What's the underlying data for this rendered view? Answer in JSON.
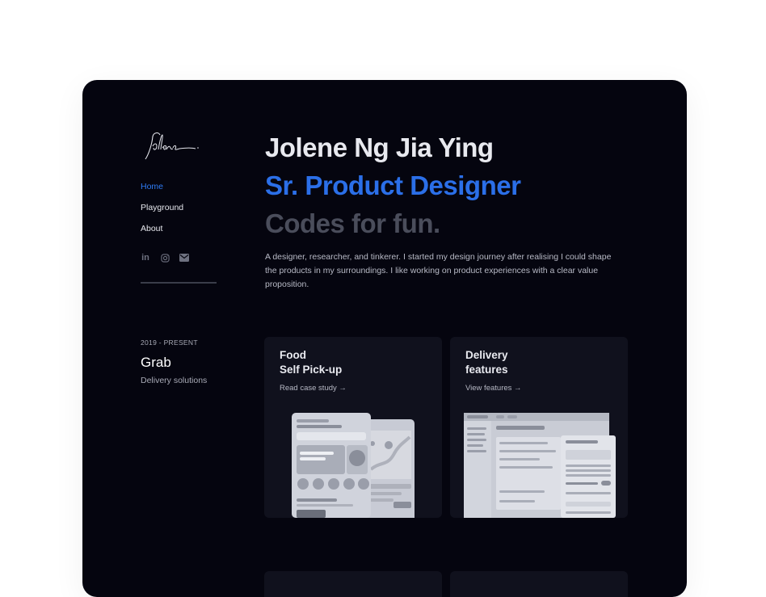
{
  "nav": {
    "items": [
      "Home",
      "Playground",
      "About"
    ]
  },
  "socials": [
    {
      "icon": "linkedin-icon",
      "label": "in"
    },
    {
      "icon": "instagram-icon"
    },
    {
      "icon": "mail-icon"
    }
  ],
  "hero": {
    "name": "Jolene Ng Jia Ying",
    "title": "Sr. Product Designer",
    "tagline": "Codes for fun.",
    "description": "A designer, researcher, and tinkerer. I started my design journey after realising I could shape the products in my surroundings. I like working on product experiences with a clear value proposition."
  },
  "experience": {
    "period": "2019 - PRESENT",
    "company": "Grab",
    "description": "Delivery solutions"
  },
  "cards": [
    {
      "title": "Food\nSelf Pick-up",
      "link": "Read case study →"
    },
    {
      "title": "Delivery\nfeatures",
      "link": "View features →"
    }
  ],
  "colors": {
    "background": "#05050f",
    "accent": "#2b6fe8",
    "card": "#10111d"
  }
}
